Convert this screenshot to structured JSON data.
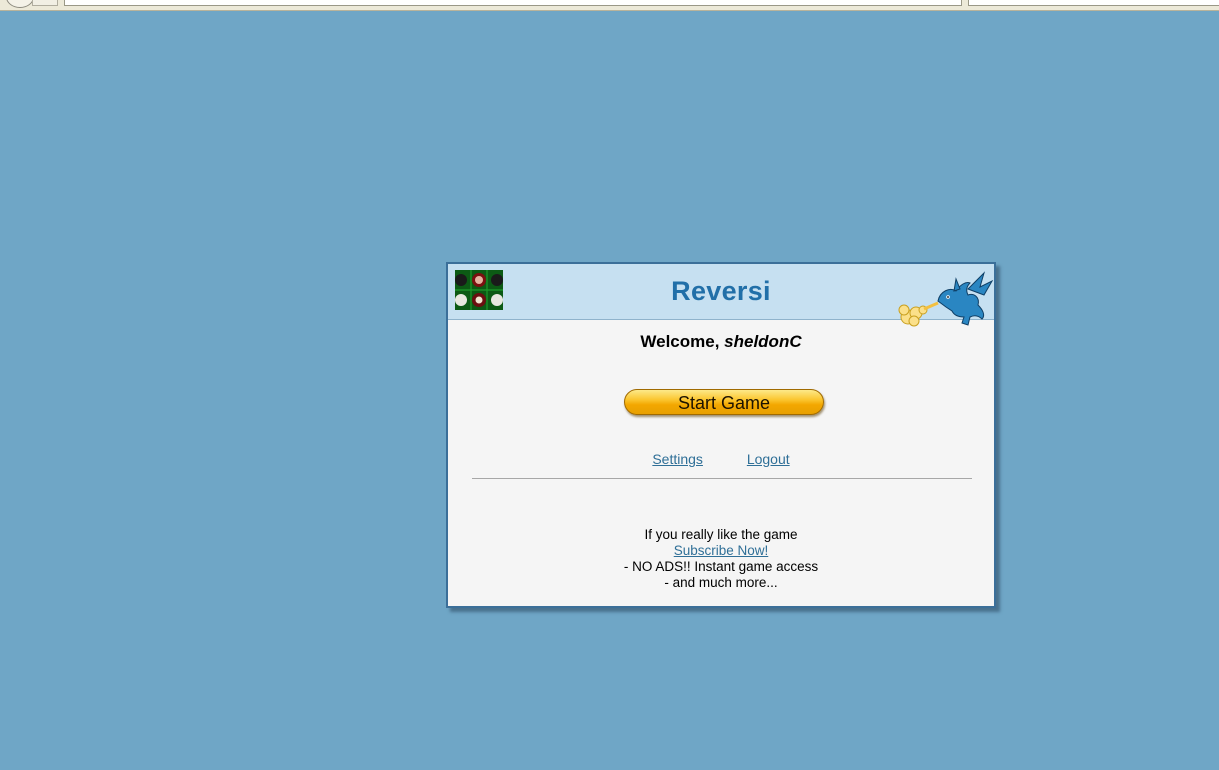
{
  "game": {
    "title": "Reversi",
    "welcome_prefix": "Welcome, ",
    "username": "sheldonC",
    "start_button": "Start Game",
    "settings_link": "Settings",
    "logout_link": "Logout"
  },
  "promo": {
    "line1": "If you really like the game",
    "subscribe_link": "Subscribe Now!",
    "line2": "- NO ADS!! Instant game access",
    "line3": "- and much more..."
  },
  "colors": {
    "page_background": "#6fa6c6",
    "header_background": "#c6e0f1",
    "title_color": "#216fa8",
    "button_gold": "#fbc630",
    "link_color": "#2f6f97"
  },
  "icons": {
    "board_logo": "reversi-board-icon",
    "mascot": "fire-breathing-dragon-icon"
  }
}
